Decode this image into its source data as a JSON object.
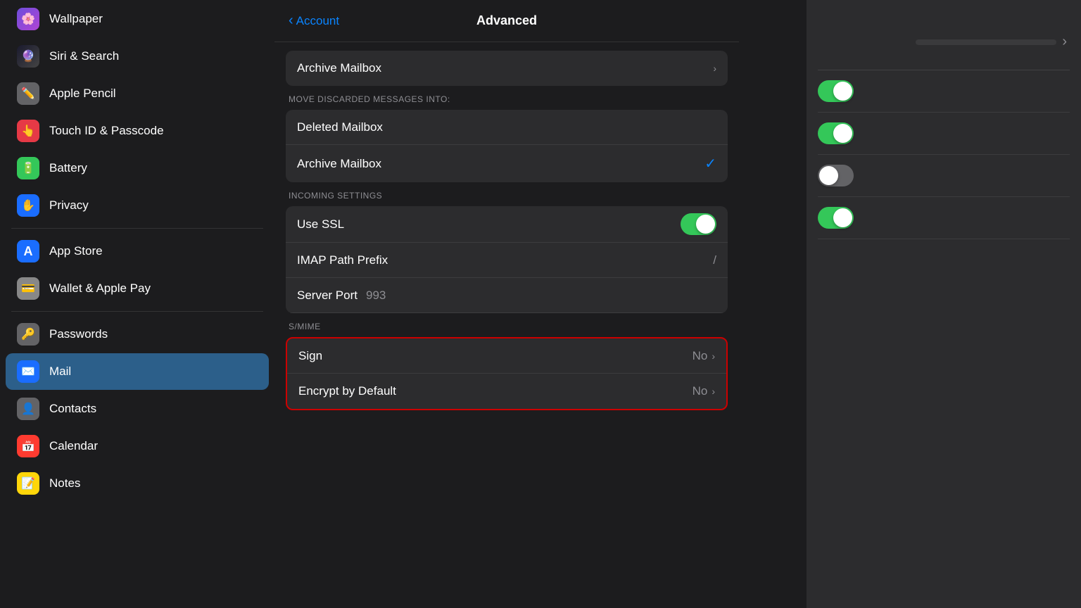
{
  "sidebar": {
    "items": [
      {
        "id": "wallpaper",
        "label": "Wallpaper",
        "icon": "🌸",
        "iconClass": "icon-wallpaper",
        "active": false
      },
      {
        "id": "siri",
        "label": "Siri & Search",
        "icon": "🔮",
        "iconClass": "icon-siri",
        "active": false
      },
      {
        "id": "pencil",
        "label": "Apple Pencil",
        "icon": "✏️",
        "iconClass": "icon-pencil",
        "active": false
      },
      {
        "id": "touchid",
        "label": "Touch ID & Passcode",
        "icon": "👆",
        "iconClass": "icon-touchid",
        "active": false
      },
      {
        "id": "battery",
        "label": "Battery",
        "icon": "🔋",
        "iconClass": "icon-battery",
        "active": false
      },
      {
        "id": "privacy",
        "label": "Privacy",
        "icon": "✋",
        "iconClass": "icon-privacy",
        "active": false
      }
    ],
    "items2": [
      {
        "id": "appstore",
        "label": "App Store",
        "icon": "A",
        "iconClass": "icon-appstore",
        "active": false
      },
      {
        "id": "wallet",
        "label": "Wallet & Apple Pay",
        "icon": "💳",
        "iconClass": "icon-wallet",
        "active": false
      }
    ],
    "items3": [
      {
        "id": "passwords",
        "label": "Passwords",
        "icon": "🔑",
        "iconClass": "icon-passwords",
        "active": false
      },
      {
        "id": "mail",
        "label": "Mail",
        "icon": "✉️",
        "iconClass": "icon-mail",
        "active": true
      },
      {
        "id": "contacts",
        "label": "Contacts",
        "icon": "👤",
        "iconClass": "icon-contacts",
        "active": false
      },
      {
        "id": "calendar",
        "label": "Calendar",
        "icon": "📅",
        "iconClass": "icon-calendar",
        "active": false
      },
      {
        "id": "notes",
        "label": "Notes",
        "icon": "📝",
        "iconClass": "icon-notes",
        "active": false
      }
    ]
  },
  "modal": {
    "back_label": "Account",
    "title": "Advanced",
    "archive_mailbox_label": "Archive Mailbox",
    "move_discarded_section": "MOVE DISCARDED MESSAGES INTO:",
    "deleted_mailbox_label": "Deleted Mailbox",
    "archive_mailbox_label2": "Archive Mailbox",
    "incoming_section": "INCOMING SETTINGS",
    "use_ssl_label": "Use SSL",
    "imap_prefix_label": "IMAP Path Prefix",
    "imap_prefix_value": "/",
    "server_port_label": "Server Port",
    "server_port_value": "993",
    "smime_section": "S/MIME",
    "sign_label": "Sign",
    "sign_value": "No",
    "encrypt_label": "Encrypt by Default",
    "encrypt_value": "No"
  },
  "right_panel": {
    "toggles": [
      {
        "id": "t1",
        "on": true
      },
      {
        "id": "t2",
        "on": true
      },
      {
        "id": "t3",
        "on": false
      },
      {
        "id": "t4",
        "on": true
      }
    ]
  }
}
